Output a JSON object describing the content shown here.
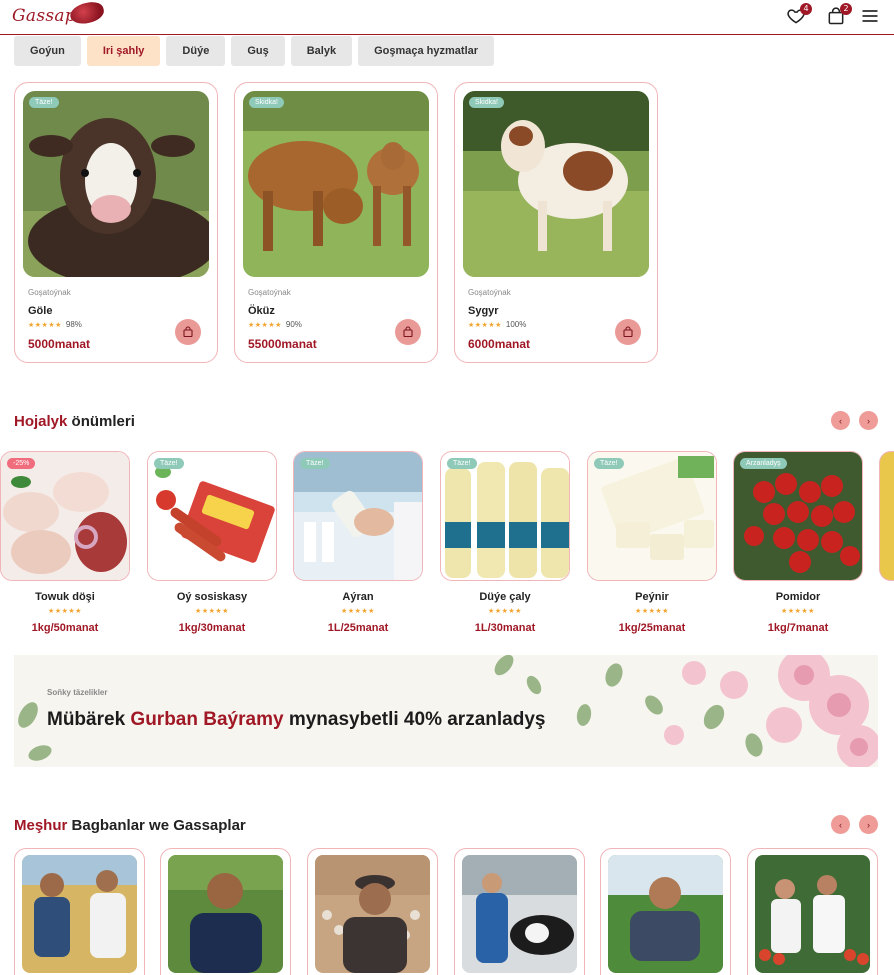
{
  "brand": {
    "name": "Gassap"
  },
  "header": {
    "wishlist_count": "4",
    "cart_count": "2"
  },
  "categories": [
    {
      "label": "Goýun",
      "active": false
    },
    {
      "label": "Iri şahly",
      "active": true
    },
    {
      "label": "Düýe",
      "active": false
    },
    {
      "label": "Guş",
      "active": false
    },
    {
      "label": "Balyk",
      "active": false
    },
    {
      "label": "Goşmaça hyzmatlar",
      "active": false
    }
  ],
  "featured": [
    {
      "tag": "Täze!",
      "category": "Goşatoýnak",
      "name": "Göle",
      "stars": "★★★★★",
      "rating": "98%",
      "price": "5000manat"
    },
    {
      "tag": "Skidka!",
      "category": "Goşatoýnak",
      "name": "Öküz",
      "stars": "★★★★★",
      "rating": "90%",
      "price": "55000manat"
    },
    {
      "tag": "Skidka!",
      "category": "Goşatoýnak",
      "name": "Sygyr",
      "stars": "★★★★★",
      "rating": "100%",
      "price": "6000manat"
    }
  ],
  "farm_section": {
    "title_highlight": "Hojalyk",
    "title_rest": "önümleri"
  },
  "farm_products": [
    {
      "tag": "-25%",
      "name": "Towuk döşi",
      "stars": "★★★★★",
      "price": "1kg/50manat"
    },
    {
      "tag": "Täze!",
      "name": "Oý sosiskasy",
      "stars": "★★★★★",
      "price": "1kg/30manat"
    },
    {
      "tag": "Täze!",
      "name": "Aýran",
      "stars": "★★★★★",
      "price": "1L/25manat"
    },
    {
      "tag": "Täze!",
      "name": "Düýe çaly",
      "stars": "★★★★★",
      "price": "1L/30manat"
    },
    {
      "tag": "Täze!",
      "name": "Peýnir",
      "stars": "★★★★★",
      "price": "1kg/25manat"
    },
    {
      "tag": "Arzanladyş",
      "name": "Pomidor",
      "stars": "★★★★★",
      "price": "1kg/7manat"
    }
  ],
  "banner": {
    "subtitle": "Soňky täzelikler",
    "title_start": "Mübärek",
    "title_highlight": "Gurban Baýramy",
    "title_end": "mynasybetli 40% arzanladyş"
  },
  "farmers_section": {
    "title_highlight": "Meşhur",
    "title_rest": "Bagbanlar we Gassaplar"
  },
  "colors": {
    "brand": "#a01826",
    "tag": "#8fc9b8",
    "active_pill": "#fde2c7",
    "card_border": "#f1b4b8"
  },
  "icons": {
    "wishlist": "heart-icon",
    "cart": "bag-icon",
    "menu": "hamburger-icon",
    "add_to_cart": "cart-add-icon",
    "prev": "chevron-left-icon",
    "next": "chevron-right-icon"
  }
}
